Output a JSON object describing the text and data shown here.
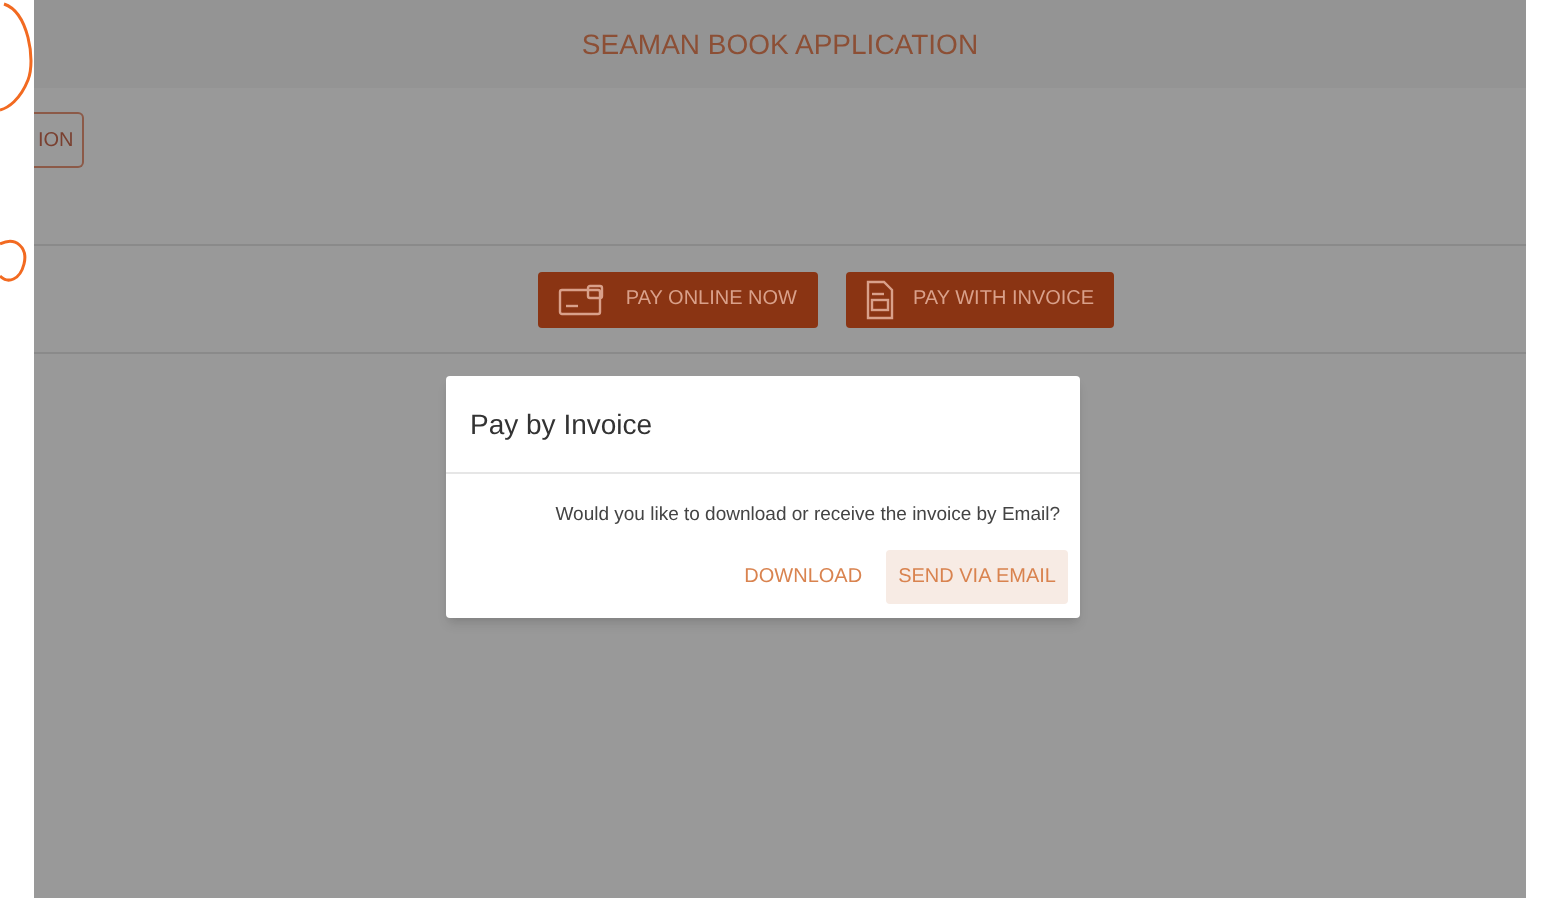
{
  "page": {
    "title": "SEAMAN BOOK APPLICATION",
    "partial_button": "ION"
  },
  "payment_buttons": [
    {
      "kind": "card",
      "label": "PAY ONLINE NOW"
    },
    {
      "kind": "invoice",
      "label": "PAY WITH INVOICE"
    }
  ],
  "dialog": {
    "title": "Pay by Invoice",
    "message": "Would you like to download or receive the invoice by Email?",
    "actions": [
      {
        "label": "DOWNLOAD",
        "selected": false
      },
      {
        "label": "SEND VIA EMAIL",
        "selected": true
      }
    ]
  }
}
